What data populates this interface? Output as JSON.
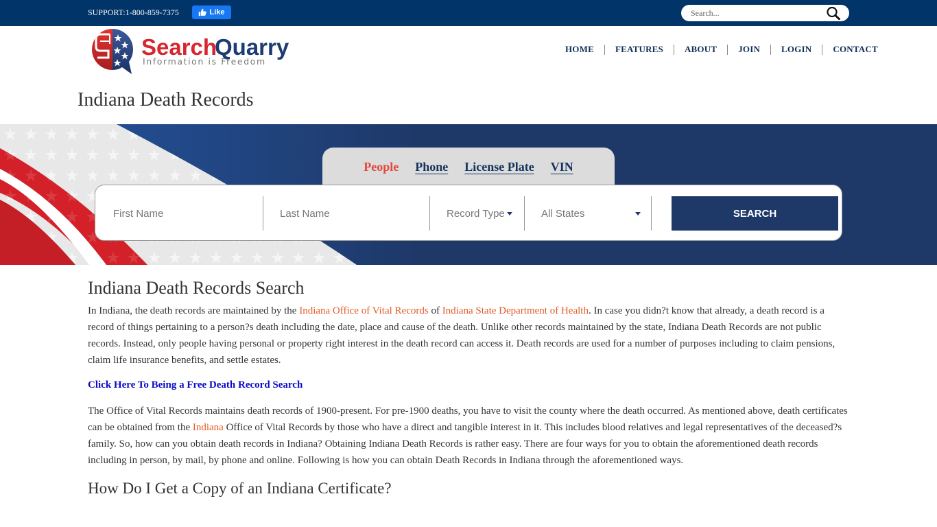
{
  "topbar": {
    "support": "SUPPORT:1-800-859-7375",
    "fb_like_label": "Like",
    "search_placeholder": "Search..."
  },
  "logo": {
    "brand_part1": "Search",
    "brand_part2": "Quarry",
    "tagline": "Information is Freedom"
  },
  "nav": {
    "items": [
      "HOME",
      "FEATURES",
      "ABOUT",
      "JOIN",
      "LOGIN",
      "CONTACT"
    ]
  },
  "page": {
    "title": "Indiana Death Records"
  },
  "search_tabs": {
    "items": [
      "People",
      "Phone",
      "License Plate",
      "VIN"
    ],
    "active": "People"
  },
  "search_form": {
    "first_name_placeholder": "First Name",
    "last_name_placeholder": "Last Name",
    "record_type": "Record Type",
    "state": "All States",
    "submit_label": "SEARCH"
  },
  "colors": {
    "navy": "#1e3868",
    "topbar": "#013468",
    "link_orange": "#e25b26",
    "active_tab_red": "#e2483a",
    "cta_blue": "#0a0ac8"
  },
  "content": {
    "heading": "Indiana Death Records Search",
    "p1": {
      "t1": "In Indiana, the death records are maintained by the ",
      "link1": "Indiana Office of Vital Records",
      "t2": " of ",
      "link2": "Indiana State Department of Health",
      "t3": ". In case you didn?t know that already, a death record is a record of things pertaining to a person?s death including the date, place and cause of the death. Unlike other records maintained by the state, Indiana Death Records are not public records. Instead, only people having personal or property right interest in the death record can access it. Death records are used for a number of purposes including to claim pensions, claim life insurance benefits, and settle estates."
    },
    "cta": "Click Here To Being a Free Death Record Search",
    "p2": {
      "t1": "The Office of Vital Records maintains death records of 1900-present. For pre-1900 deaths, you have to visit the county where the death occurred. As mentioned above, death certificates can be obtained from the ",
      "link1": "Indiana",
      "t2": " Office of Vital Records by those who have a direct and tangible interest in it. This includes blood relatives and legal representatives of the deceased?s family. So, how can you obtain death records in Indiana? Obtaining Indiana Death Records is rather easy. There are four ways for you to obtain the aforementioned death records including in person, by mail, by phone and online. Following is how you can obtain Death Records in Indiana through the aforementioned ways."
    },
    "subheading": "How Do I Get a Copy of an Indiana Certificate?"
  }
}
